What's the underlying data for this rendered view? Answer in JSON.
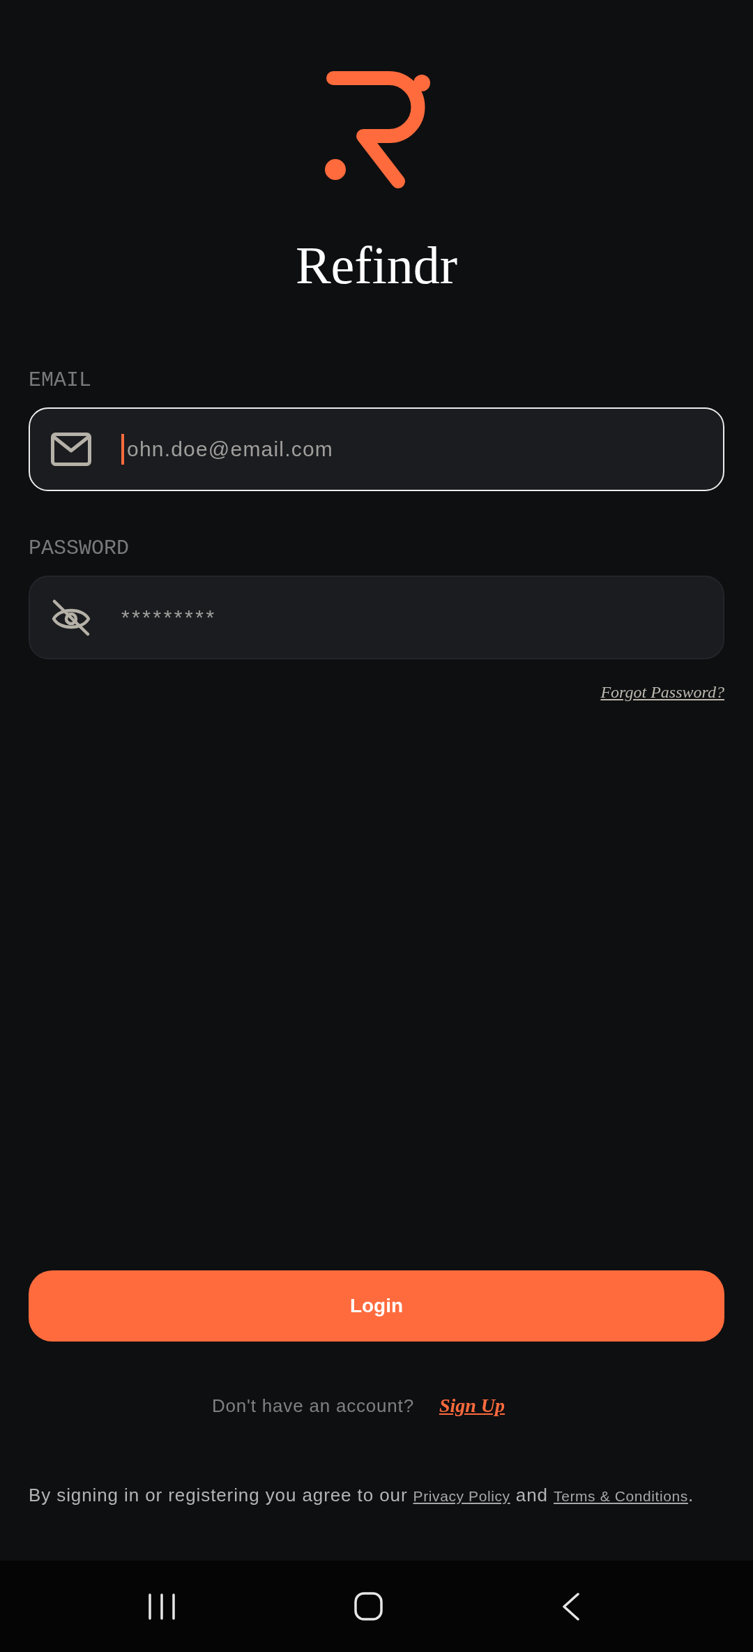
{
  "logo": {
    "wordmark": "Refindr"
  },
  "fields": [
    {
      "kind": "email",
      "label": "EMAIL",
      "value": "ohn.doe@email.com",
      "focused": true
    },
    {
      "kind": "password",
      "label": "PASSWORD",
      "value": "*********",
      "focused": false
    }
  ],
  "forgot_password": "Forgot Password?",
  "login_button": "Login",
  "signup": {
    "prompt": "Don't have an account?",
    "link": "Sign Up"
  },
  "legal": {
    "text": "By signing in or registering you agree to our",
    "privacy_link": "Privacy Policy",
    "joiner": "and",
    "terms_link": "Terms & Conditions",
    "end": "."
  }
}
